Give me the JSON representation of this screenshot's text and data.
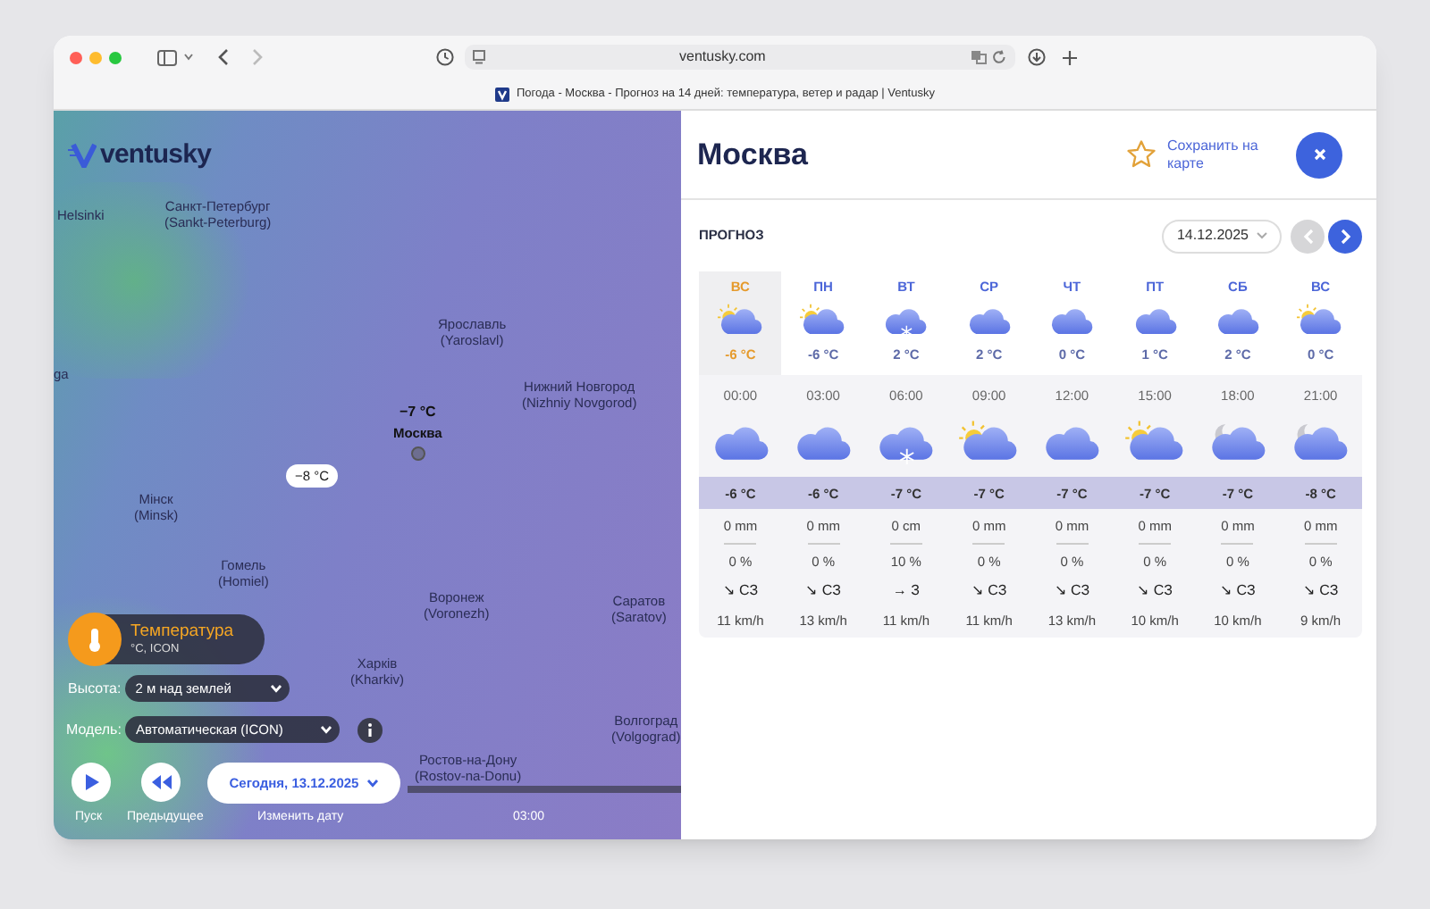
{
  "browser": {
    "url": "ventusky.com",
    "tab_title": "Погода - Москва - Прогноз на 14 дней: температура, ветер и радар | Ventusky"
  },
  "map": {
    "logo": "ventusky",
    "cities": [
      {
        "name": "Helsinki"
      },
      {
        "name": "Санкт-Петербург",
        "latin": "(Sankt-Peterburg)"
      },
      {
        "name": "ga"
      },
      {
        "name": "Ярославль",
        "latin": "(Yaroslavl)"
      },
      {
        "name": "Нижний Новгород",
        "latin": "(Nizhniy Novgorod)"
      },
      {
        "name": "Мінск",
        "latin": "(Minsk)"
      },
      {
        "name": "Гомель",
        "latin": "(Homiel)"
      },
      {
        "name": "Воронеж",
        "latin": "(Voronezh)"
      },
      {
        "name": "Саратов",
        "latin": "(Saratov)"
      },
      {
        "name": "Харків",
        "latin": "(Kharkiv)"
      },
      {
        "name": "Волгоград",
        "latin": "(Volgograd)"
      },
      {
        "name": "Ростов-на-Дону",
        "latin": "(Rostov-na-Donu)"
      }
    ],
    "city_temp": "−7 °C",
    "city_name": "Москва",
    "pin_temp": "−8 °C",
    "layer": {
      "title": "Температура",
      "subtitle": "°C, ICON"
    },
    "height": {
      "label": "Высота:",
      "value": "2 м над землей"
    },
    "model": {
      "label": "Модель:",
      "value": "Автоматическая (ICON)"
    },
    "play_label": "Пуск",
    "prev_label": "Предыдущее",
    "date": "Сегодня, 13.12.2025",
    "change_date": "Изменить дату",
    "time": "03:00"
  },
  "panel": {
    "title": "Москва",
    "save": "Сохранить на карте",
    "section": "ПРОГНОЗ",
    "date": "14.12.2025",
    "prev_disabled": true,
    "days": [
      {
        "label": "ВС",
        "kind": "sun-cloud",
        "temp": "-6 °C",
        "selected": true
      },
      {
        "label": "ПН",
        "kind": "sun-cloud",
        "temp": "-6 °C",
        "selected": false
      },
      {
        "label": "ВТ",
        "kind": "snow-cloud",
        "temp": "2 °C",
        "selected": false
      },
      {
        "label": "СР",
        "kind": "cloud",
        "temp": "2 °C",
        "selected": false
      },
      {
        "label": "ЧТ",
        "kind": "cloud",
        "temp": "0 °C",
        "selected": false
      },
      {
        "label": "ПТ",
        "kind": "cloud",
        "temp": "1 °C",
        "selected": false
      },
      {
        "label": "СБ",
        "kind": "cloud",
        "temp": "2 °C",
        "selected": false
      },
      {
        "label": "ВС",
        "kind": "sun-cloud",
        "temp": "0 °C",
        "selected": false
      }
    ],
    "hours": [
      {
        "time": "00:00",
        "kind": "cloud",
        "temp": "-6 °C",
        "precip": "0 mm",
        "prob": "0 %",
        "wind": "↘ СЗ",
        "speed": "11 km/h"
      },
      {
        "time": "03:00",
        "kind": "cloud",
        "temp": "-6 °C",
        "precip": "0 mm",
        "prob": "0 %",
        "wind": "↘ СЗ",
        "speed": "13 km/h"
      },
      {
        "time": "06:00",
        "kind": "snow-cloud",
        "temp": "-7 °C",
        "precip": "0 cm",
        "prob": "10 %",
        "wind": "→ З",
        "speed": "11 km/h"
      },
      {
        "time": "09:00",
        "kind": "sun-cloud",
        "temp": "-7 °C",
        "precip": "0 mm",
        "prob": "0 %",
        "wind": "↘ СЗ",
        "speed": "11 km/h"
      },
      {
        "time": "12:00",
        "kind": "cloud",
        "temp": "-7 °C",
        "precip": "0 mm",
        "prob": "0 %",
        "wind": "↘ СЗ",
        "speed": "13 km/h"
      },
      {
        "time": "15:00",
        "kind": "sun-cloud",
        "temp": "-7 °C",
        "precip": "0 mm",
        "prob": "0 %",
        "wind": "↘ СЗ",
        "speed": "10 km/h"
      },
      {
        "time": "18:00",
        "kind": "moon-cloud",
        "temp": "-7 °C",
        "precip": "0 mm",
        "prob": "0 %",
        "wind": "↘ СЗ",
        "speed": "10 km/h"
      },
      {
        "time": "21:00",
        "kind": "moon-cloud",
        "temp": "-8 °C",
        "precip": "0 mm",
        "prob": "0 %",
        "wind": "↘ СЗ",
        "speed": "9 km/h"
      }
    ]
  }
}
